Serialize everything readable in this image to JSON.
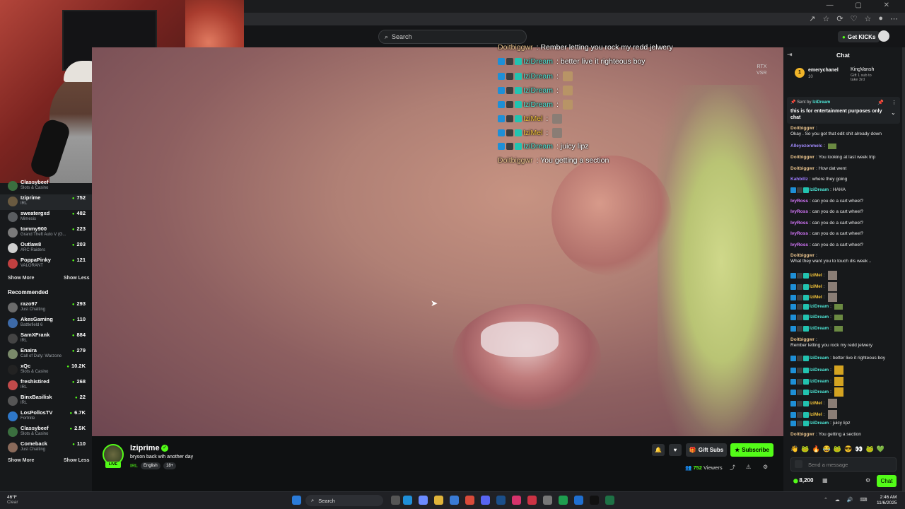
{
  "browser": {
    "window_controls": "— ▢ ✕",
    "address_icons": [
      "↗",
      "☆",
      "⟳",
      "♡",
      "☆",
      "●",
      "⋯"
    ]
  },
  "header": {
    "search_placeholder": "Search",
    "get_kicks_label": "Get KICKs"
  },
  "sidebar": {
    "channels": [
      {
        "name": "Classybeef",
        "sub": "Slots & Casino",
        "viewers": "",
        "color": "#3b6f3f"
      },
      {
        "name": "Iziprime",
        "sub": "IRL",
        "viewers": "752",
        "color": "#6a5a40"
      },
      {
        "name": "sweatergxd",
        "sub": "Mimesis",
        "viewers": "482",
        "color": "#5a5d60"
      },
      {
        "name": "tommy900",
        "sub": "Grand Theft Auto V (G...",
        "viewers": "223",
        "color": "#7a7a7a"
      },
      {
        "name": "Outlaw8",
        "sub": "ARC Raiders",
        "viewers": "203",
        "color": "#cfcfcf"
      },
      {
        "name": "PoppaPinky",
        "sub": "VALORANT",
        "viewers": "121",
        "color": "#c04040"
      }
    ],
    "show_more": "Show More",
    "show_less": "Show Less",
    "recommended_heading": "Recommended",
    "recommended": [
      {
        "name": "razo97",
        "sub": "Just Chatting",
        "viewers": "293",
        "color": "#6b6b6b"
      },
      {
        "name": "AkesGaming",
        "sub": "Battlefield 6",
        "viewers": "110",
        "color": "#3d6aa8"
      },
      {
        "name": "SamXFrank",
        "sub": "IRL",
        "viewers": "884",
        "color": "#444"
      },
      {
        "name": "Enaira",
        "sub": "Call of Duty: Warzone",
        "viewers": "279",
        "color": "#7a8a6a"
      },
      {
        "name": "xQc",
        "sub": "Slots & Casino",
        "viewers": "10.2K",
        "color": "#222"
      },
      {
        "name": "freshistired",
        "sub": "IRL",
        "viewers": "268",
        "color": "#c04a4a"
      },
      {
        "name": "BinxBasilisk",
        "sub": "IRL",
        "viewers": "22",
        "color": "#555"
      },
      {
        "name": "LosPollosTV",
        "sub": "Fortnite",
        "viewers": "6.7K",
        "color": "#2e77c8"
      },
      {
        "name": "Classybeef",
        "sub": "Slots & Casino",
        "viewers": "2.5K",
        "color": "#3b6f3f"
      },
      {
        "name": "Comeback",
        "sub": "Just Chatting",
        "viewers": "110",
        "color": "#8a6a5a"
      }
    ]
  },
  "player": {
    "rtx_label_1": "RTX",
    "rtx_label_2": "VSR",
    "overlay_chat": [
      {
        "user": "Doitbiggwr",
        "text": ": Rember letting you rock my redd jelwery",
        "cls": "un-doit",
        "badges": false,
        "emote": ""
      },
      {
        "user": "IziDream",
        "text": ": better live it righteous boy",
        "cls": "un-izi",
        "badges": true,
        "emote": ""
      },
      {
        "user": "IziDream",
        "text": ":",
        "cls": "un-izi",
        "badges": true,
        "emote": "y"
      },
      {
        "user": "IziDream",
        "text": ":",
        "cls": "un-izi",
        "badges": true,
        "emote": "y"
      },
      {
        "user": "IziDream",
        "text": ":",
        "cls": "un-izi",
        "badges": true,
        "emote": "y"
      },
      {
        "user": "IziMel",
        "text": ":",
        "cls": "un-mel",
        "badges": true,
        "emote": "g"
      },
      {
        "user": "IziMel",
        "text": ":",
        "cls": "un-mel",
        "badges": true,
        "emote": "g"
      },
      {
        "user": "IziDream",
        "text": ": juicy lipz",
        "cls": "un-izi",
        "badges": true,
        "emote": ""
      },
      {
        "user": "Doitbiggwr",
        "text": ": You getting a section",
        "cls": "un-doit",
        "badges": false,
        "emote": ""
      }
    ]
  },
  "stream_info": {
    "streamer": "Iziprime",
    "live_label": "LIVE",
    "title": "bryson back wih another day",
    "category": "IRL",
    "tags": [
      "English",
      "18+"
    ],
    "gift_subs_label": "Gift Subs",
    "subscribe_label": "Subscribe",
    "viewer_count": "752",
    "viewers_label": "Viewers"
  },
  "chat": {
    "title": "Chat",
    "leaderboard": {
      "rank": "1",
      "name": "emerychanel",
      "count": "10"
    },
    "gift_leader": {
      "name": "KingVansh",
      "text": "Gift 1 sub to take 3rd"
    },
    "pinned": {
      "sent_by_label": "Sent by",
      "sender": "IziDream",
      "message": "this is for entertainment purposes only chat"
    },
    "messages": [
      {
        "user": "Doitbiggwr",
        "cls": "c-doit",
        "text": "Okay . So you got that edit shit already down",
        "badges": false,
        "emote": ""
      },
      {
        "user": "Alleyezonmelc",
        "cls": "c-alle",
        "text": "",
        "badges": false,
        "emote": "f"
      },
      {
        "user": "Doitbiggwr",
        "cls": "c-doit",
        "text": "You looking at last week trip",
        "badges": false,
        "emote": ""
      },
      {
        "user": "Doitbiggwr",
        "cls": "c-doit",
        "text": "How dat went",
        "badges": false,
        "emote": ""
      },
      {
        "user": "Kahbillz",
        "cls": "c-kah",
        "text": "where they going",
        "badges": false,
        "emote": ""
      },
      {
        "user": "IziDream",
        "cls": "c-izi",
        "text": "HAHA",
        "badges": true,
        "emote": ""
      },
      {
        "user": "IvyRoss",
        "cls": "c-ivy",
        "text": "can you do a cart wheel?",
        "badges": false,
        "emote": ""
      },
      {
        "user": "IvyRoss",
        "cls": "c-ivy",
        "text": "can you do a cart wheel?",
        "badges": false,
        "emote": ""
      },
      {
        "user": "IvyRoss",
        "cls": "c-ivy",
        "text": "can you do a cart wheel?",
        "badges": false,
        "emote": ""
      },
      {
        "user": "IvyRoss",
        "cls": "c-ivy",
        "text": "can you do a cart wheel?",
        "badges": false,
        "emote": ""
      },
      {
        "user": "IvyRoss",
        "cls": "c-ivy",
        "text": "can you do a cart wheel?",
        "badges": false,
        "emote": ""
      },
      {
        "user": "Doitbiggwr",
        "cls": "c-doit",
        "text": "What they want you to touch dis week ..",
        "badges": false,
        "emote": ""
      },
      {
        "user": "IziMel",
        "cls": "c-mel",
        "text": "",
        "badges": true,
        "emote": "g"
      },
      {
        "user": "IziMel",
        "cls": "c-mel",
        "text": "",
        "badges": true,
        "emote": "g"
      },
      {
        "user": "IziMel",
        "cls": "c-mel",
        "text": "",
        "badges": true,
        "emote": "g"
      },
      {
        "user": "IziDream",
        "cls": "c-izi",
        "text": "",
        "badges": true,
        "emote": "f"
      },
      {
        "user": "IziDream",
        "cls": "c-izi",
        "text": "",
        "badges": true,
        "emote": "f"
      },
      {
        "user": "IziDream",
        "cls": "c-izi",
        "text": "",
        "badges": true,
        "emote": "f"
      },
      {
        "user": "Doitbiggwr",
        "cls": "c-doit",
        "text": "Rember letting you rock my redd jelwery",
        "badges": false,
        "emote": ""
      },
      {
        "user": "IziDream",
        "cls": "c-izi",
        "text": "better live it righteous boy",
        "badges": true,
        "emote": ""
      },
      {
        "user": "IziDream",
        "cls": "c-izi",
        "text": "",
        "badges": true,
        "emote": "y"
      },
      {
        "user": "IziDream",
        "cls": "c-izi",
        "text": "",
        "badges": true,
        "emote": "y"
      },
      {
        "user": "IziDream",
        "cls": "c-izi",
        "text": "",
        "badges": true,
        "emote": "y"
      },
      {
        "user": "IziMel",
        "cls": "c-mel",
        "text": "",
        "badges": true,
        "emote": "g"
      },
      {
        "user": "IziMel",
        "cls": "c-mel",
        "text": "",
        "badges": true,
        "emote": "g"
      },
      {
        "user": "IziDream",
        "cls": "c-izi",
        "text": "juicy lipz",
        "badges": true,
        "emote": ""
      },
      {
        "user": "Doitbiggwr",
        "cls": "c-doit",
        "text": "You getting a section",
        "badges": false,
        "emote": ""
      }
    ],
    "input_placeholder": "Send a message",
    "points": "8,200",
    "send_label": "Chat"
  },
  "taskbar": {
    "weather_temp": "46°F",
    "weather_cond": "Clear",
    "search_label": "Search",
    "time": "2:46 AM",
    "date": "11/6/2025"
  },
  "colors": {
    "kick_green": "#53fc18",
    "bg": "#0b0e0f",
    "panel": "#17191b"
  }
}
